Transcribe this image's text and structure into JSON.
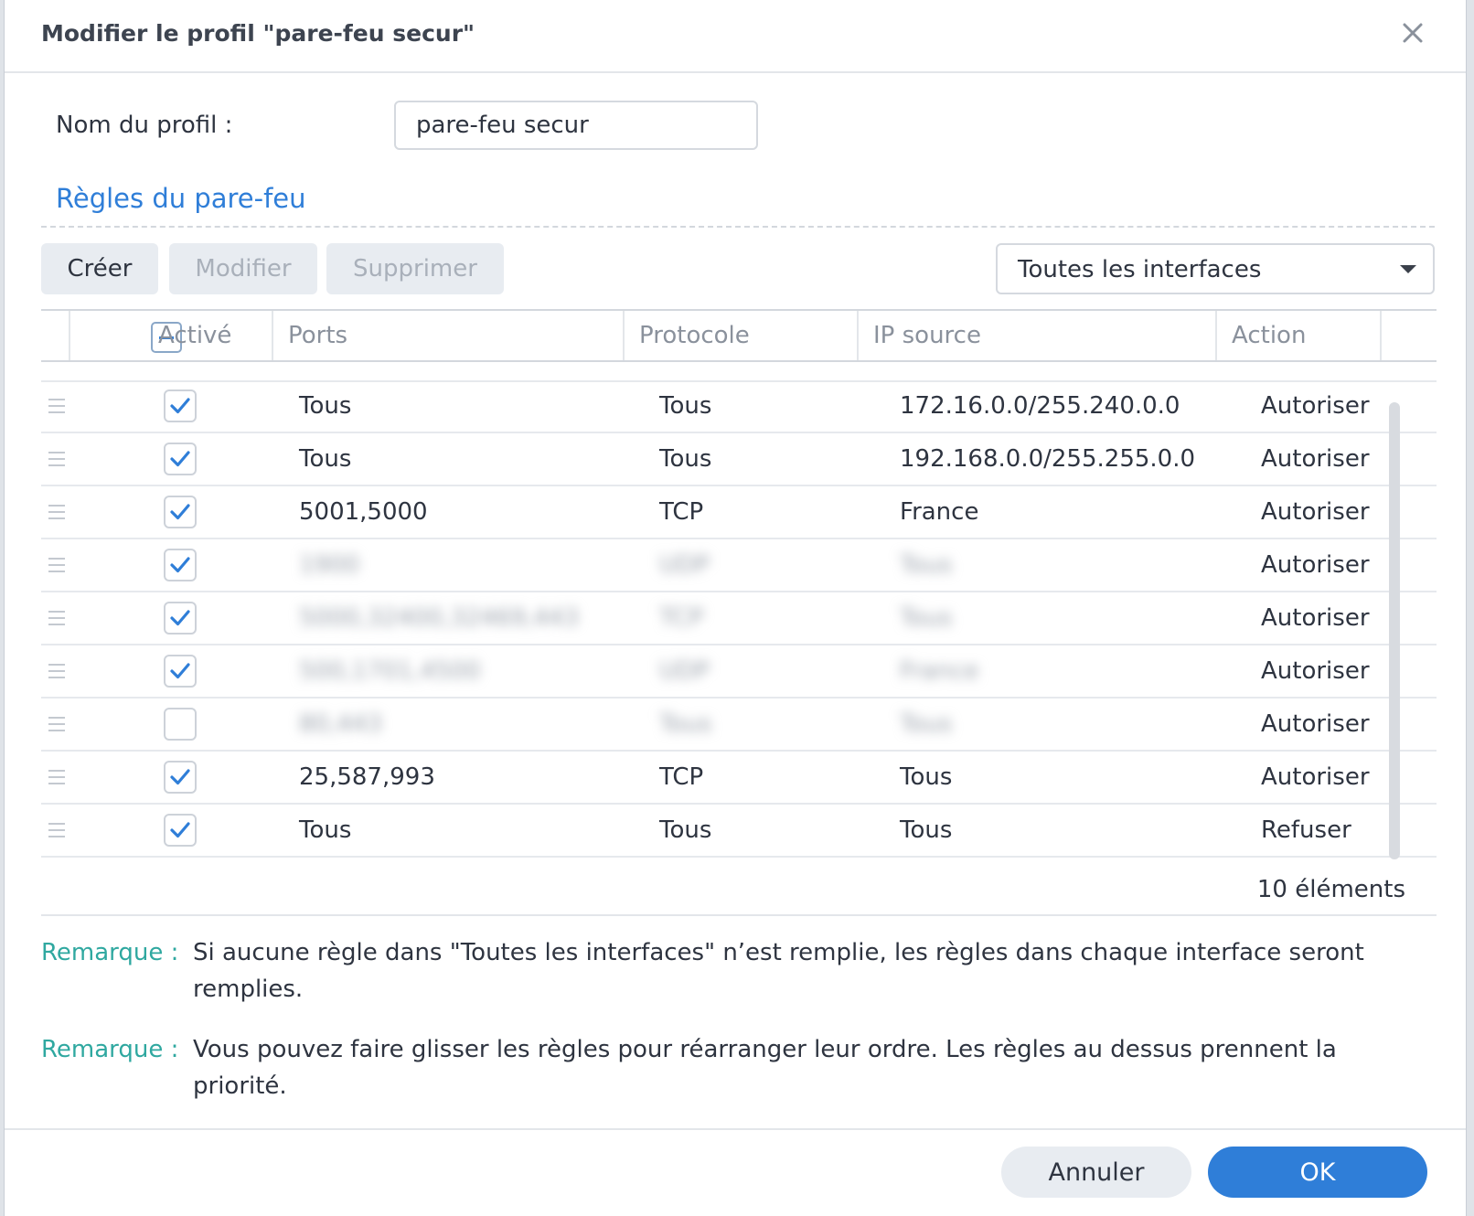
{
  "dialog": {
    "title": "Modifier le profil \"pare-feu secur\"",
    "close_icon": "close-icon"
  },
  "profile": {
    "name_label": "Nom du profil :",
    "name_value": "pare-feu secur"
  },
  "rules_section": {
    "title": "Règles du pare-feu"
  },
  "toolbar": {
    "create_label": "Créer",
    "edit_label": "Modifier",
    "delete_label": "Supprimer",
    "interface_selected": "Toutes les interfaces"
  },
  "table": {
    "headers": {
      "active": "Activé",
      "ports": "Ports",
      "protocol": "Protocole",
      "source_ip": "IP source",
      "action": "Action"
    },
    "rows": [
      {
        "active": true,
        "ports": "Tous",
        "protocol": "Tous",
        "source_ip": "172.16.0.0/255.240.0.0",
        "action": "Autoriser",
        "blurred": false
      },
      {
        "active": true,
        "ports": "Tous",
        "protocol": "Tous",
        "source_ip": "192.168.0.0/255.255.0.0",
        "action": "Autoriser",
        "blurred": false
      },
      {
        "active": true,
        "ports": "5001,5000",
        "protocol": "TCP",
        "source_ip": "France",
        "action": "Autoriser",
        "blurred": false
      },
      {
        "active": true,
        "ports": "1900",
        "protocol": "UDP",
        "source_ip": "Tous",
        "action": "Autoriser",
        "blurred": true
      },
      {
        "active": true,
        "ports": "5000,32400,32469,443",
        "protocol": "TCP",
        "source_ip": "Tous",
        "action": "Autoriser",
        "blurred": true
      },
      {
        "active": true,
        "ports": "500,1701,4500",
        "protocol": "UDP",
        "source_ip": "France",
        "action": "Autoriser",
        "blurred": true
      },
      {
        "active": false,
        "ports": "80,443",
        "protocol": "Tous",
        "source_ip": "Tous",
        "action": "Autoriser",
        "blurred": true
      },
      {
        "active": true,
        "ports": "25,587,993",
        "protocol": "TCP",
        "source_ip": "Tous",
        "action": "Autoriser",
        "blurred": false
      },
      {
        "active": true,
        "ports": "Tous",
        "protocol": "Tous",
        "source_ip": "Tous",
        "action": "Refuser",
        "blurred": false
      }
    ],
    "count_label": "10 éléments"
  },
  "notes": [
    {
      "label": "Remarque :",
      "text": "Si aucune règle dans \"Toutes les interfaces\" n’est remplie, les règles dans chaque interface seront remplies."
    },
    {
      "label": "Remarque :",
      "text": "Vous pouvez faire glisser les règles pour réarranger leur ordre. Les règles au dessus prennent la priorité."
    }
  ],
  "footer": {
    "cancel_label": "Annuler",
    "ok_label": "OK"
  },
  "colors": {
    "accent": "#2f7ed8",
    "note_label": "#2fa8a0",
    "button_bg": "#e8ecf1"
  }
}
